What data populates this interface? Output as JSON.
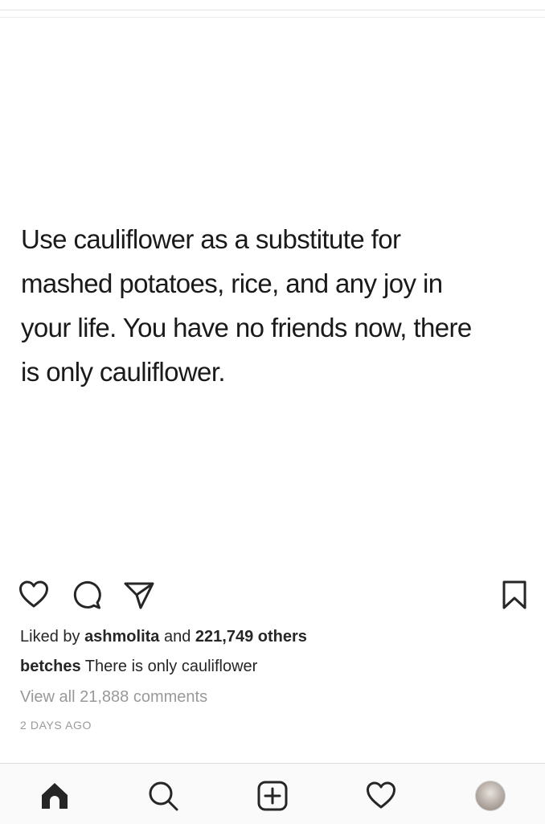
{
  "post": {
    "text": "Use cauliflower as a substitute for\nmashed potatoes, rice, and any joy in\nyour life. You have no friends now, there\nis only cauliflower."
  },
  "actions": {
    "like_icon": "heart-outline-icon",
    "comment_icon": "comment-bubble-icon",
    "share_icon": "paper-plane-icon",
    "save_icon": "bookmark-icon"
  },
  "likes": {
    "prefix": "Liked by ",
    "user": "ashmolita",
    "middle": " and ",
    "count": "221,749 others"
  },
  "caption": {
    "username": "betches",
    "text": " There is only cauliflower"
  },
  "comments": {
    "view_all": "View all 21,888 comments"
  },
  "timestamp": "2 DAYS AGO",
  "tabbar": {
    "items": [
      {
        "icon": "home-icon"
      },
      {
        "icon": "search-icon"
      },
      {
        "icon": "add-post-icon"
      },
      {
        "icon": "activity-heart-icon"
      },
      {
        "icon": "profile-avatar"
      }
    ]
  }
}
